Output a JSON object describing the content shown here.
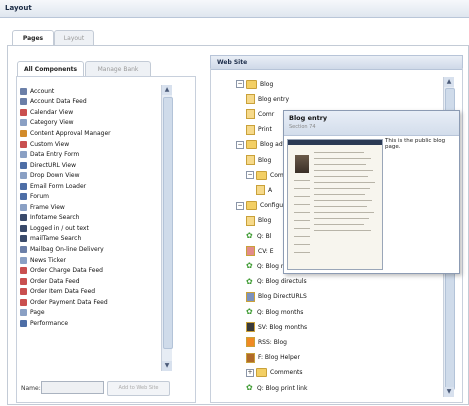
{
  "window": {
    "title": "Layout"
  },
  "outer_tabs": [
    {
      "label": "Pages",
      "active": true
    },
    {
      "label": "Layout",
      "active": false
    }
  ],
  "left_panel": {
    "tabs": [
      {
        "label": "All Components",
        "active": true
      },
      {
        "label": "Manage Bank",
        "active": false
      }
    ],
    "components": [
      {
        "label": "Account",
        "icon": "users-icon",
        "color": "#6b7fa8"
      },
      {
        "label": "Account Data Feed",
        "icon": "users-icon",
        "color": "#6b7fa8"
      },
      {
        "label": "Calendar View",
        "icon": "calendar-icon",
        "color": "#c94f4f"
      },
      {
        "label": "Category View",
        "icon": "page-icon",
        "color": "#8aa0c4"
      },
      {
        "label": "Content Approval Manager",
        "icon": "approval-icon",
        "color": "#d28b2b"
      },
      {
        "label": "Custom View",
        "icon": "custom-icon",
        "color": "#c94f4f"
      },
      {
        "label": "Data Entry Form",
        "icon": "form-icon",
        "color": "#8aa0c4"
      },
      {
        "label": "DirectURL View",
        "icon": "url-icon",
        "color": "#4e6ea6"
      },
      {
        "label": "Drop Down View",
        "icon": "dropdown-icon",
        "color": "#8aa0c4"
      },
      {
        "label": "Email Form Loader",
        "icon": "email-icon",
        "color": "#4e6ea6"
      },
      {
        "label": "Forum",
        "icon": "forum-icon",
        "color": "#4e6ea6"
      },
      {
        "label": "Frame View",
        "icon": "frame-icon",
        "color": "#8aa0c4"
      },
      {
        "label": "Infotame Search",
        "icon": "search-icon",
        "color": "#3a4a6a"
      },
      {
        "label": "Logged in / out text",
        "icon": "login-icon",
        "color": "#3a4a6a"
      },
      {
        "label": "mailTame Search",
        "icon": "search-icon",
        "color": "#3a4a6a"
      },
      {
        "label": "Mailbag On-line Delivery",
        "icon": "mail-icon",
        "color": "#6b7fa8"
      },
      {
        "label": "News Ticker",
        "icon": "news-icon",
        "color": "#8aa0c4"
      },
      {
        "label": "Order Charge Data Feed",
        "icon": "order-icon",
        "color": "#c94f4f"
      },
      {
        "label": "Order Data Feed",
        "icon": "order-icon",
        "color": "#c94f4f"
      },
      {
        "label": "Order Item Data Feed",
        "icon": "order-icon",
        "color": "#c94f4f"
      },
      {
        "label": "Order Payment Data Feed",
        "icon": "order-icon",
        "color": "#c94f4f"
      },
      {
        "label": "Page",
        "icon": "page-icon",
        "color": "#8aa0c4"
      },
      {
        "label": "Performance",
        "icon": "chart-icon",
        "color": "#4e6ea6"
      }
    ],
    "name_label": "Name:",
    "add_button": "Add to Web Site"
  },
  "right_panel": {
    "title": "Web Site",
    "tree": [
      {
        "label": "Blog",
        "type": "folder",
        "indent": 1,
        "expander": "minus"
      },
      {
        "label": "Blog entry",
        "type": "page",
        "indent": 2
      },
      {
        "label": "Comr",
        "type": "page",
        "indent": 2
      },
      {
        "label": "Print",
        "type": "page",
        "indent": 2
      },
      {
        "label": "Blog adv",
        "type": "folder",
        "indent": 1,
        "expander": "minus"
      },
      {
        "label": "Blog",
        "type": "page",
        "indent": 2
      },
      {
        "label": "Comr",
        "type": "folder",
        "indent": 2,
        "expander": "minus"
      },
      {
        "label": "A",
        "type": "page",
        "indent": 3
      },
      {
        "label": "Configur",
        "type": "folder",
        "indent": 1,
        "expander": "minus"
      },
      {
        "label": "Blog",
        "type": "page",
        "indent": 2
      },
      {
        "label": "Q: Bl",
        "type": "gear",
        "indent": 2
      },
      {
        "label": "CV: E",
        "type": "custom",
        "indent": 2
      },
      {
        "label": "Q: Blog recent",
        "type": "gear",
        "indent": 2
      },
      {
        "label": "Q: Blog directuls",
        "type": "gear",
        "indent": 2
      },
      {
        "label": "Blog DirectURLS",
        "type": "url",
        "indent": 2
      },
      {
        "label": "Q: Blog months",
        "type": "gear",
        "indent": 2
      },
      {
        "label": "SV: Blog months",
        "type": "sv",
        "indent": 2
      },
      {
        "label": "RSS: Blog",
        "type": "rss",
        "indent": 2
      },
      {
        "label": "F: Blog Helper",
        "type": "book",
        "indent": 2
      },
      {
        "label": "Comments",
        "type": "folder",
        "indent": 2,
        "expander": "plus"
      },
      {
        "label": "Q: Blog print link",
        "type": "gear",
        "indent": 2
      }
    ],
    "popup": {
      "title": "Blog entry",
      "subtitle": "Section    74",
      "description": "This is the public blog page."
    }
  }
}
